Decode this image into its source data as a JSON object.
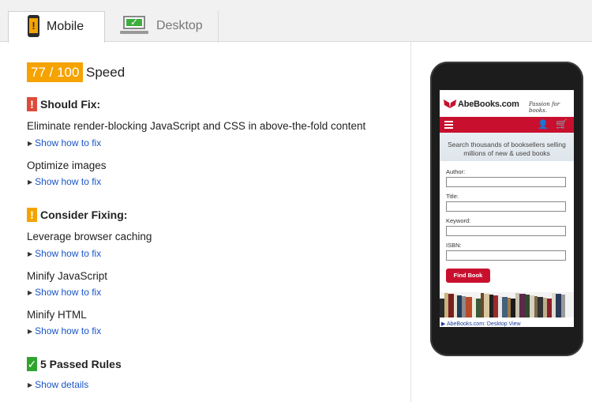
{
  "tabs": {
    "mobile_label": "Mobile",
    "desktop_label": "Desktop",
    "mobile_icon_glyph": "!",
    "desktop_icon_glyph": "✓"
  },
  "score": {
    "value": "77 / 100",
    "label": "Speed",
    "color": "#f4a300"
  },
  "should_fix": {
    "badge": "!",
    "title": "Should Fix:",
    "color": "#dd4b39",
    "rules": [
      {
        "name": "Eliminate render-blocking JavaScript and CSS in above-the-fold content",
        "link": "Show how to fix"
      },
      {
        "name": "Optimize images",
        "link": "Show how to fix"
      }
    ]
  },
  "consider_fixing": {
    "badge": "!",
    "title": "Consider Fixing:",
    "color": "#f4a300",
    "rules": [
      {
        "name": "Leverage browser caching",
        "link": "Show how to fix"
      },
      {
        "name": "Minify JavaScript",
        "link": "Show how to fix"
      },
      {
        "name": "Minify HTML",
        "link": "Show how to fix"
      }
    ]
  },
  "passed": {
    "badge": "✓",
    "title": "5 Passed Rules",
    "color": "#2fa52f",
    "link": "Show details"
  },
  "phone_preview": {
    "site_name": "AbeBooks.com",
    "tagline": "Passion for books.",
    "search_text": "Search thousands of booksellers selling millions of new & used books",
    "fields": [
      "Author:",
      "Title:",
      "Keyword:",
      "ISBN:"
    ],
    "button": "Find Book",
    "footer_link": "AbeBooks.com: Desktop View",
    "brand_color": "#c8102e"
  }
}
